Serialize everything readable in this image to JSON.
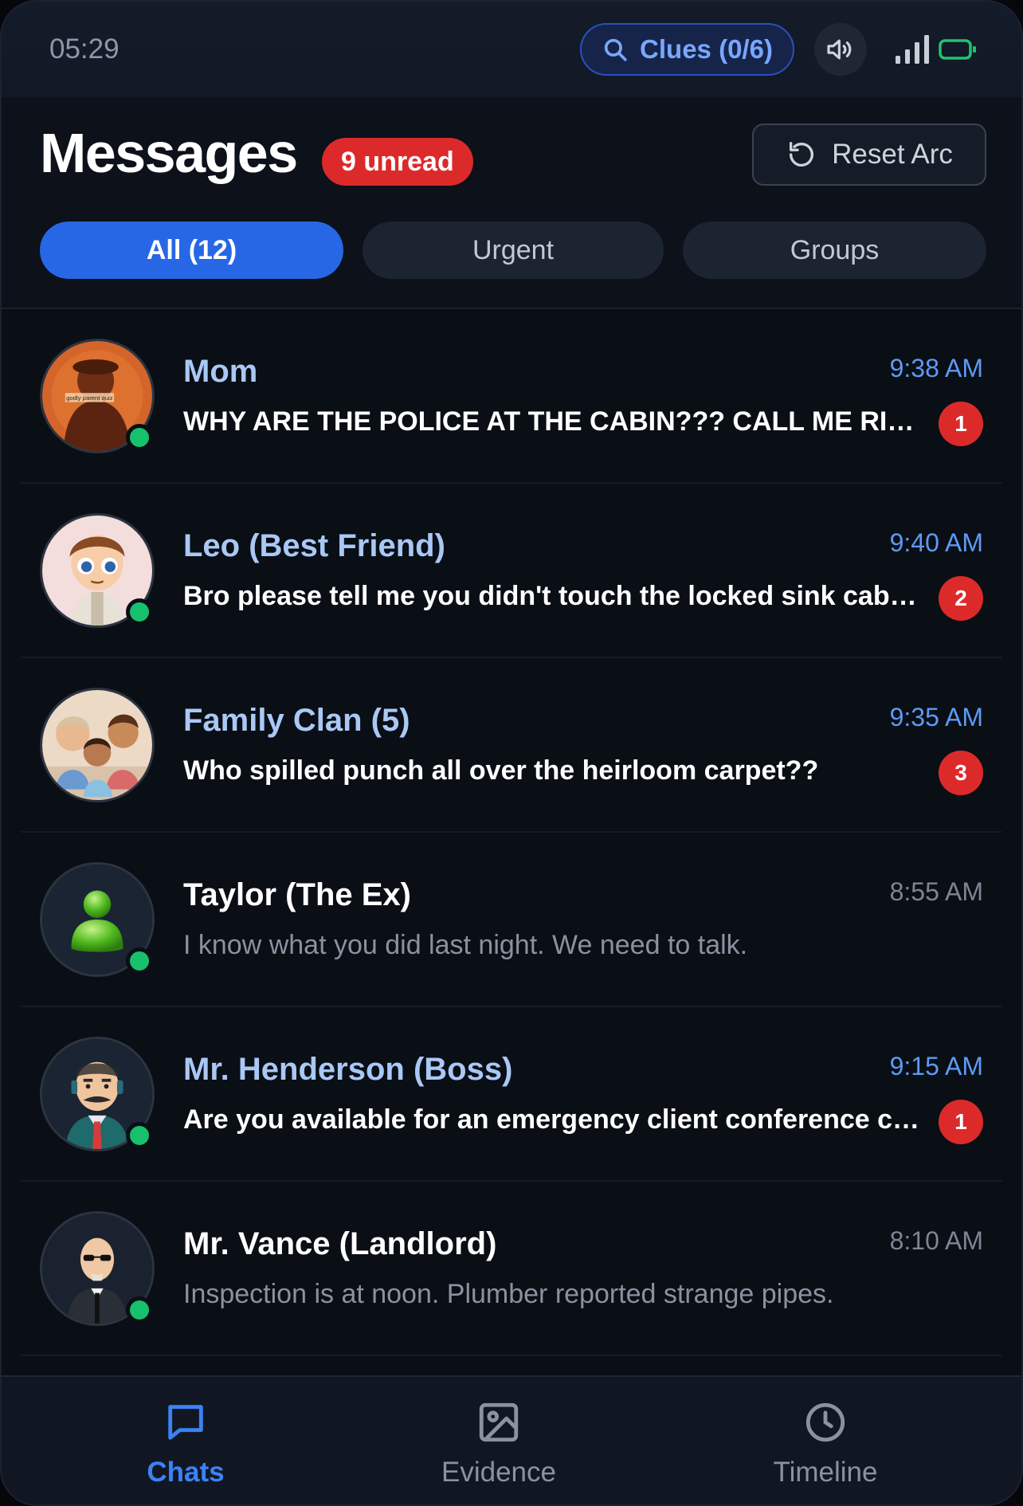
{
  "status_bar": {
    "time": "05:29",
    "clues_label": "Clues (0/6)",
    "icons": [
      "search-icon",
      "speaker-icon",
      "signal-icon",
      "battery-icon"
    ]
  },
  "header": {
    "title": "Messages",
    "unread_badge": "9 unread",
    "reset_label": "Reset Arc"
  },
  "tabs": [
    {
      "label": "All (12)",
      "active": true
    },
    {
      "label": "Urgent",
      "active": false
    },
    {
      "label": "Groups",
      "active": false
    }
  ],
  "chats": [
    {
      "name": "Mom",
      "time": "9:38 AM",
      "preview": "WHY ARE THE POLICE AT THE CABIN??? CALL ME RIGHT NOW",
      "unread": "1",
      "avatar": "mom-avatar",
      "online": true
    },
    {
      "name": "Leo (Best Friend)",
      "time": "9:40 AM",
      "preview": "Bro please tell me you didn't touch the locked sink cabinet",
      "unread": "2",
      "avatar": "leo-avatar",
      "online": true
    },
    {
      "name": "Family Clan (5)",
      "time": "9:35 AM",
      "preview": "Who spilled punch all over the heirloom carpet??",
      "unread": "3",
      "avatar": "family-avatar",
      "online": false
    },
    {
      "name": "Taylor (The Ex)",
      "time": "8:55 AM",
      "preview": "I know what you did last night. We need to talk.",
      "unread": "",
      "avatar": "generic-user-avatar",
      "online": true
    },
    {
      "name": "Mr. Henderson (Boss)",
      "time": "9:15 AM",
      "preview": "Are you available for an emergency client conference call?",
      "unread": "1",
      "avatar": "boss-avatar",
      "online": true
    },
    {
      "name": "Mr. Vance (Landlord)",
      "time": "8:10 AM",
      "preview": "Inspection is at noon. Plumber reported strange pipes.",
      "unread": "",
      "avatar": "landlord-avatar",
      "online": true
    }
  ],
  "nav": [
    {
      "label": "Chats",
      "icon": "chat-bubble-icon",
      "active": true
    },
    {
      "label": "Evidence",
      "icon": "image-icon",
      "active": false
    },
    {
      "label": "Timeline",
      "icon": "clock-icon",
      "active": false
    }
  ],
  "colors": {
    "accent": "#2767e6",
    "unread_red": "#dc2a2a",
    "online_green": "#17c06c",
    "background": "#0a0e15"
  }
}
